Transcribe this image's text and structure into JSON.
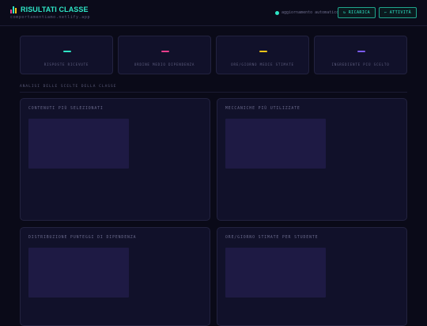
{
  "header": {
    "title": "RISULTATI CLASSE",
    "subtitle": "comportamentiamo.netlify.app",
    "auto_update": "aggiornamento automatico",
    "refresh_label": "↻ RICARICA",
    "activity_label": "← ATTIVITÀ"
  },
  "stats": [
    {
      "label": "RISPOSTE RICEVUTE",
      "accent": "#2ee6c6"
    },
    {
      "label": "ORDINE MEDIO DIPENDENZA",
      "accent": "#e83e8c"
    },
    {
      "label": "ORE/GIORNO MEDIE STIMATE",
      "accent": "#f5c518"
    },
    {
      "label": "INGREDIENTE PIÙ SCELTO",
      "accent": "#7b5cf0"
    }
  ],
  "section": {
    "title": "ANALISI DELLE SCELTE DELLA CLASSE"
  },
  "panels": [
    {
      "title": "CONTENUTI PIÙ SELEZIONATI"
    },
    {
      "title": "MECCANICHE PIÙ UTILIZZATE"
    },
    {
      "title": "DISTRIBUZIONE PUNTEGGI DI DIPENDENZA"
    },
    {
      "title": "ORE/GIORNO STIMATE PER STUDENTE"
    }
  ],
  "colors": {
    "accent": "#2ee6c6",
    "background": "#0a0a18",
    "panel": "#11112a",
    "placeholder": "#1e1a44"
  }
}
